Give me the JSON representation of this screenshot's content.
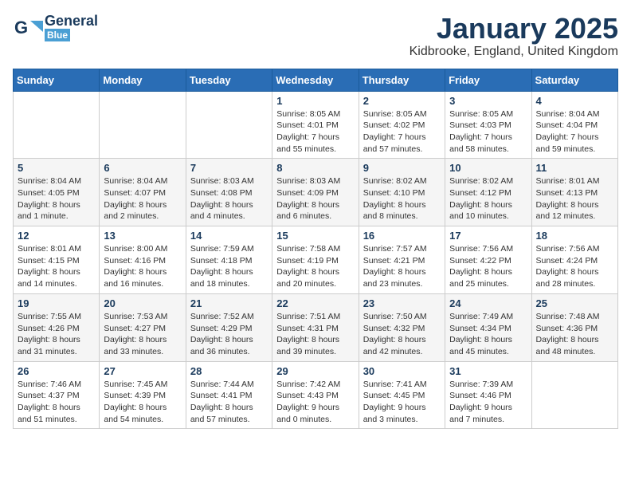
{
  "logo": {
    "general": "General",
    "blue": "Blue"
  },
  "title": "January 2025",
  "location": "Kidbrooke, England, United Kingdom",
  "headers": [
    "Sunday",
    "Monday",
    "Tuesday",
    "Wednesday",
    "Thursday",
    "Friday",
    "Saturday"
  ],
  "weeks": [
    [
      {
        "day": "",
        "info": ""
      },
      {
        "day": "",
        "info": ""
      },
      {
        "day": "",
        "info": ""
      },
      {
        "day": "1",
        "info": "Sunrise: 8:05 AM\nSunset: 4:01 PM\nDaylight: 7 hours and 55 minutes."
      },
      {
        "day": "2",
        "info": "Sunrise: 8:05 AM\nSunset: 4:02 PM\nDaylight: 7 hours and 57 minutes."
      },
      {
        "day": "3",
        "info": "Sunrise: 8:05 AM\nSunset: 4:03 PM\nDaylight: 7 hours and 58 minutes."
      },
      {
        "day": "4",
        "info": "Sunrise: 8:04 AM\nSunset: 4:04 PM\nDaylight: 7 hours and 59 minutes."
      }
    ],
    [
      {
        "day": "5",
        "info": "Sunrise: 8:04 AM\nSunset: 4:05 PM\nDaylight: 8 hours and 1 minute."
      },
      {
        "day": "6",
        "info": "Sunrise: 8:04 AM\nSunset: 4:07 PM\nDaylight: 8 hours and 2 minutes."
      },
      {
        "day": "7",
        "info": "Sunrise: 8:03 AM\nSunset: 4:08 PM\nDaylight: 8 hours and 4 minutes."
      },
      {
        "day": "8",
        "info": "Sunrise: 8:03 AM\nSunset: 4:09 PM\nDaylight: 8 hours and 6 minutes."
      },
      {
        "day": "9",
        "info": "Sunrise: 8:02 AM\nSunset: 4:10 PM\nDaylight: 8 hours and 8 minutes."
      },
      {
        "day": "10",
        "info": "Sunrise: 8:02 AM\nSunset: 4:12 PM\nDaylight: 8 hours and 10 minutes."
      },
      {
        "day": "11",
        "info": "Sunrise: 8:01 AM\nSunset: 4:13 PM\nDaylight: 8 hours and 12 minutes."
      }
    ],
    [
      {
        "day": "12",
        "info": "Sunrise: 8:01 AM\nSunset: 4:15 PM\nDaylight: 8 hours and 14 minutes."
      },
      {
        "day": "13",
        "info": "Sunrise: 8:00 AM\nSunset: 4:16 PM\nDaylight: 8 hours and 16 minutes."
      },
      {
        "day": "14",
        "info": "Sunrise: 7:59 AM\nSunset: 4:18 PM\nDaylight: 8 hours and 18 minutes."
      },
      {
        "day": "15",
        "info": "Sunrise: 7:58 AM\nSunset: 4:19 PM\nDaylight: 8 hours and 20 minutes."
      },
      {
        "day": "16",
        "info": "Sunrise: 7:57 AM\nSunset: 4:21 PM\nDaylight: 8 hours and 23 minutes."
      },
      {
        "day": "17",
        "info": "Sunrise: 7:56 AM\nSunset: 4:22 PM\nDaylight: 8 hours and 25 minutes."
      },
      {
        "day": "18",
        "info": "Sunrise: 7:56 AM\nSunset: 4:24 PM\nDaylight: 8 hours and 28 minutes."
      }
    ],
    [
      {
        "day": "19",
        "info": "Sunrise: 7:55 AM\nSunset: 4:26 PM\nDaylight: 8 hours and 31 minutes."
      },
      {
        "day": "20",
        "info": "Sunrise: 7:53 AM\nSunset: 4:27 PM\nDaylight: 8 hours and 33 minutes."
      },
      {
        "day": "21",
        "info": "Sunrise: 7:52 AM\nSunset: 4:29 PM\nDaylight: 8 hours and 36 minutes."
      },
      {
        "day": "22",
        "info": "Sunrise: 7:51 AM\nSunset: 4:31 PM\nDaylight: 8 hours and 39 minutes."
      },
      {
        "day": "23",
        "info": "Sunrise: 7:50 AM\nSunset: 4:32 PM\nDaylight: 8 hours and 42 minutes."
      },
      {
        "day": "24",
        "info": "Sunrise: 7:49 AM\nSunset: 4:34 PM\nDaylight: 8 hours and 45 minutes."
      },
      {
        "day": "25",
        "info": "Sunrise: 7:48 AM\nSunset: 4:36 PM\nDaylight: 8 hours and 48 minutes."
      }
    ],
    [
      {
        "day": "26",
        "info": "Sunrise: 7:46 AM\nSunset: 4:37 PM\nDaylight: 8 hours and 51 minutes."
      },
      {
        "day": "27",
        "info": "Sunrise: 7:45 AM\nSunset: 4:39 PM\nDaylight: 8 hours and 54 minutes."
      },
      {
        "day": "28",
        "info": "Sunrise: 7:44 AM\nSunset: 4:41 PM\nDaylight: 8 hours and 57 minutes."
      },
      {
        "day": "29",
        "info": "Sunrise: 7:42 AM\nSunset: 4:43 PM\nDaylight: 9 hours and 0 minutes."
      },
      {
        "day": "30",
        "info": "Sunrise: 7:41 AM\nSunset: 4:45 PM\nDaylight: 9 hours and 3 minutes."
      },
      {
        "day": "31",
        "info": "Sunrise: 7:39 AM\nSunset: 4:46 PM\nDaylight: 9 hours and 7 minutes."
      },
      {
        "day": "",
        "info": ""
      }
    ]
  ]
}
